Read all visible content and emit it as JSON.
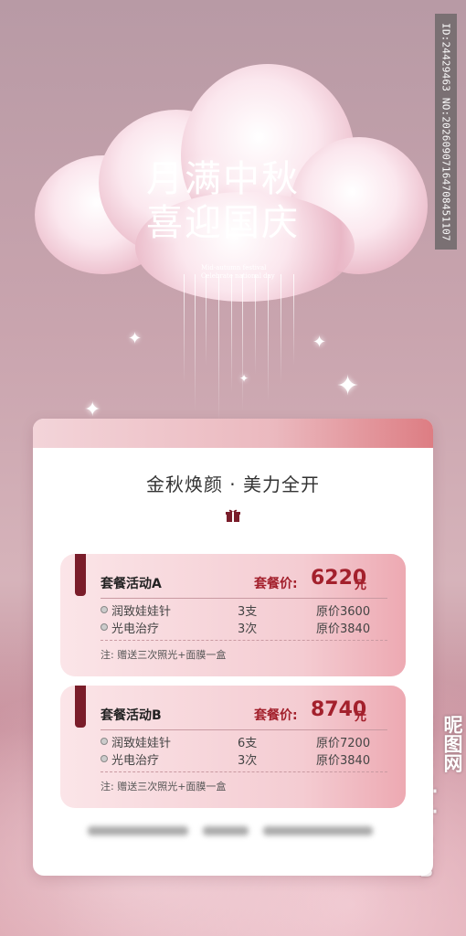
{
  "hero": {
    "title_line1": "月满中秋",
    "title_line2": "喜迎国庆",
    "subtitle_line1": "Mid-autumn festival",
    "subtitle_line2": "Celebrate national day"
  },
  "watermark": {
    "id_text": "ID:24429463 NO:20260907164708451107",
    "site_text": "昵图网 www.nipic.com"
  },
  "card": {
    "heading": "金秋焕颜 · 美力全开",
    "packages": [
      {
        "name": "套餐活动A",
        "price_label": "套餐价:",
        "price": "6220",
        "unit": "元",
        "items": [
          {
            "item": "润致娃娃针",
            "qty": "3支",
            "orig": "原价3600"
          },
          {
            "item": "光电治疗",
            "qty": "3次",
            "orig": "原价3840"
          }
        ],
        "note": "注: 赠送三次照光+面膜一盒"
      },
      {
        "name": "套餐活动B",
        "price_label": "套餐价:",
        "price": "8740",
        "unit": "元",
        "items": [
          {
            "item": "润致娃娃针",
            "qty": "6支",
            "orig": "原价7200"
          },
          {
            "item": "光电治疗",
            "qty": "3次",
            "orig": "原价3840"
          }
        ],
        "note": "注: 赠送三次照光+面膜一盒"
      }
    ]
  },
  "colors": {
    "accent": "#a3202c",
    "tab": "#7a1d2a"
  }
}
